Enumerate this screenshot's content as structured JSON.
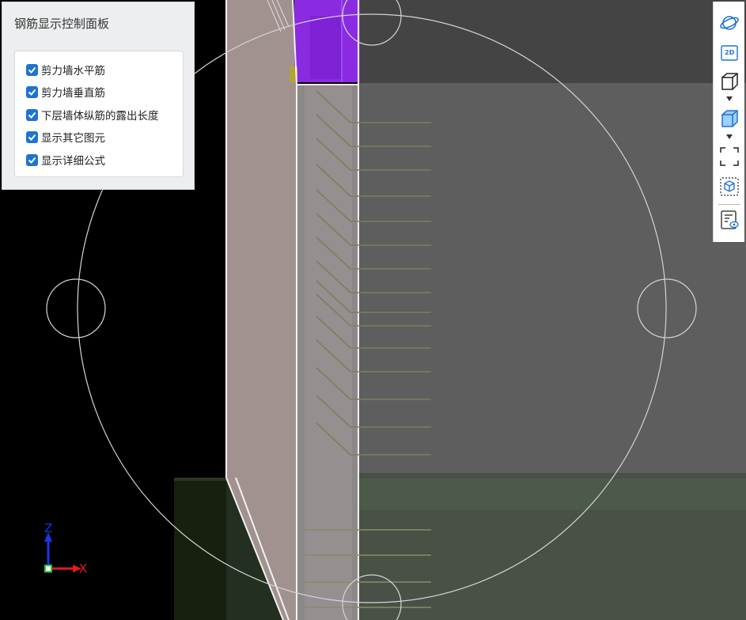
{
  "panel": {
    "title": "钢筋显示控制面板",
    "options": [
      {
        "label": "剪力墙水平筋",
        "checked": true
      },
      {
        "label": "剪力墙垂直筋",
        "checked": true
      },
      {
        "label": "下层墙体纵筋的露出长度",
        "checked": true
      },
      {
        "label": "显示其它图元",
        "checked": true
      },
      {
        "label": "显示详细公式",
        "checked": true
      }
    ]
  },
  "toolbar": {
    "items": [
      {
        "name": "orbit-icon"
      },
      {
        "name": "view-2d-icon",
        "text": "2D"
      },
      {
        "name": "wireframe-cube-icon"
      },
      {
        "name": "dropdown-arrow-icon"
      },
      {
        "name": "solid-cube-icon"
      },
      {
        "name": "dropdown-arrow-icon"
      },
      {
        "name": "fullscreen-icon"
      },
      {
        "name": "box-select-icon"
      },
      {
        "name": "properties-list-icon"
      }
    ]
  },
  "axes": {
    "x_label": "X",
    "z_label": "Z",
    "x_color": "#e21b1b",
    "z_color": "#1c35e6"
  },
  "colors": {
    "accent": "#1f73d1",
    "wall_face": "#a49590",
    "concrete_dark": "#444444",
    "concrete_mid": "#5d5d5d",
    "rebar": "#8c8c6a",
    "column_purple": "#8a2be2",
    "ground_green": "#3c4a38"
  }
}
